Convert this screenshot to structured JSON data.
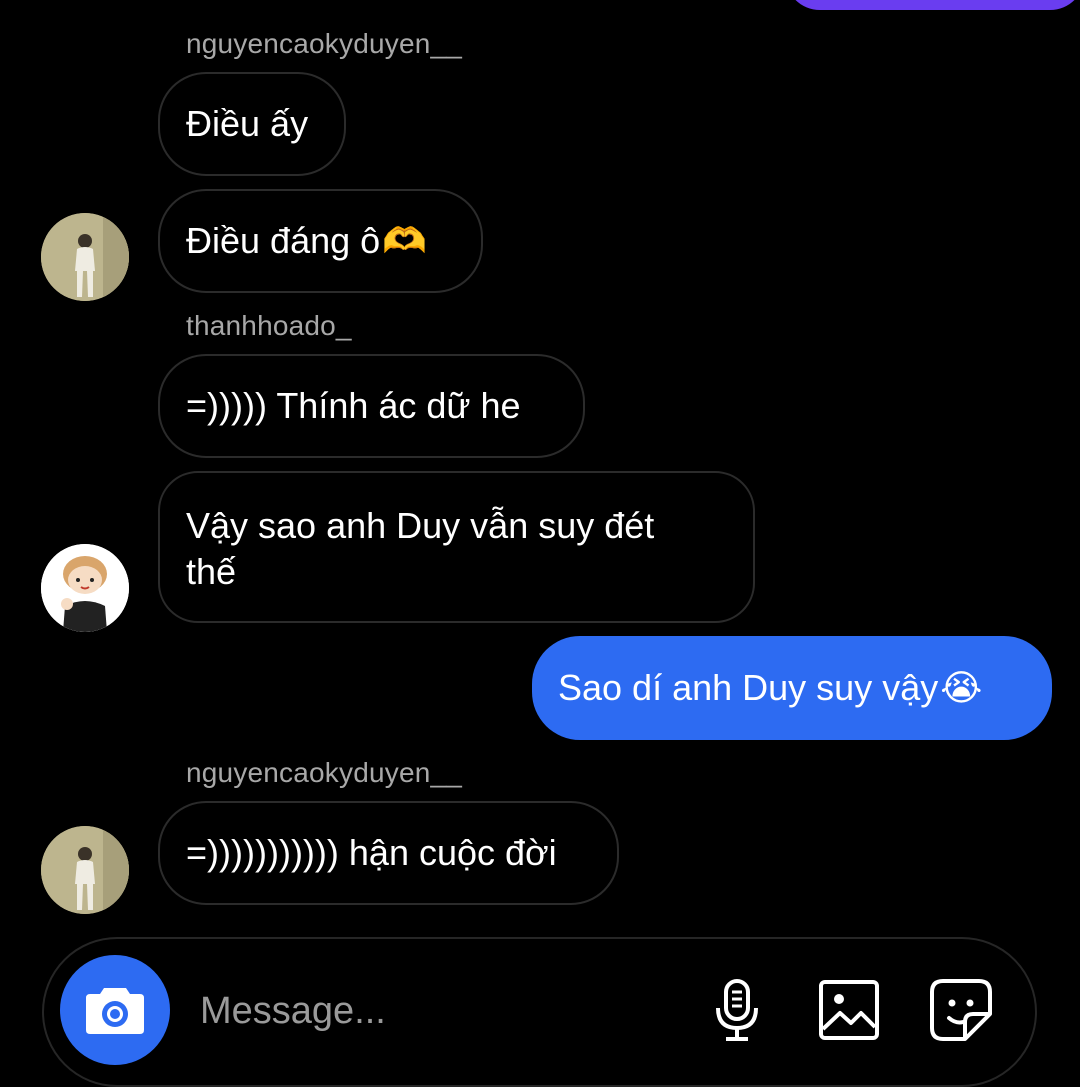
{
  "conversation": {
    "messages": [
      {
        "sender": "nguyencaokyduyen__",
        "text": "Điều ấy"
      },
      {
        "sender": "nguyencaokyduyen__",
        "text": "Điều đáng ô",
        "emoji": "🫶"
      },
      {
        "sender": "thanhhoado_",
        "text": "=))))) Thính ác dữ he"
      },
      {
        "sender": "thanhhoado_",
        "text": "Vậy sao anh Duy vẫn suy đét thế"
      },
      {
        "sender": "me",
        "text": "Sao dí anh Duy suy vậy",
        "emoji": "😭"
      },
      {
        "sender": "nguyencaokyduyen__",
        "text": "=))))))))))) hận cuộc đời"
      }
    ],
    "usernames": [
      "nguyencaokyduyen__",
      "thanhhoado_",
      "nguyencaokyduyen__"
    ]
  },
  "composer": {
    "placeholder": "Message...",
    "icons": {
      "camera": "camera-icon",
      "mic": "microphone-icon",
      "gallery": "gallery-icon",
      "sticker": "sticker-icon"
    },
    "accent": "#2d6bf2"
  },
  "colors": {
    "background": "#000000",
    "own_bubble": "#2d6bf2",
    "top_bubble": "#6a3df0",
    "username": "#a8a8a8"
  }
}
